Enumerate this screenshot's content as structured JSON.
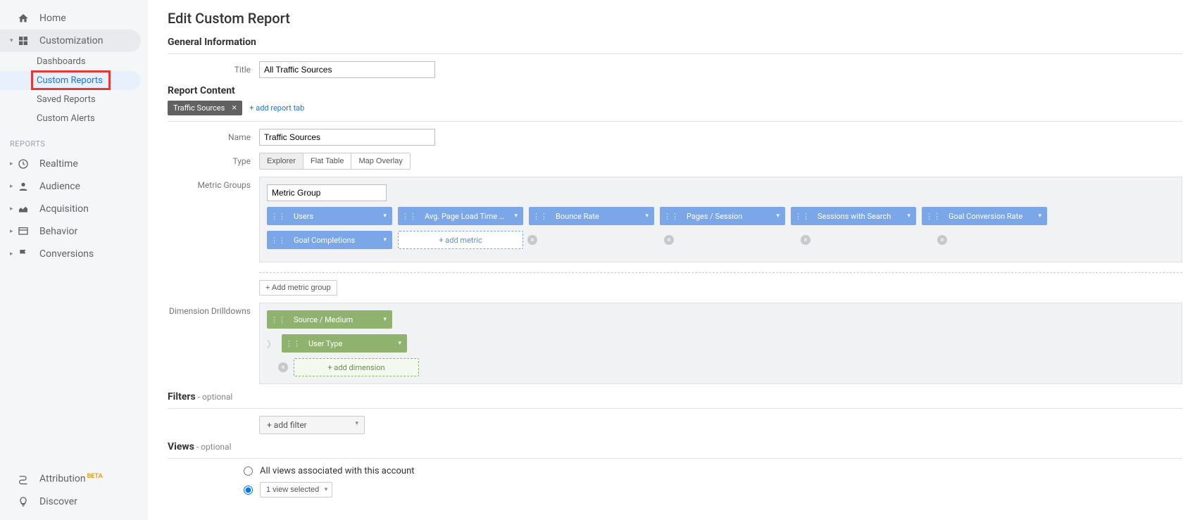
{
  "sidebar": {
    "home": "Home",
    "customization": "Customization",
    "sub": {
      "dashboards": "Dashboards",
      "custom_reports": "Custom Reports",
      "saved_reports": "Saved Reports",
      "custom_alerts": "Custom Alerts"
    },
    "reports_label": "REPORTS",
    "realtime": "Realtime",
    "audience": "Audience",
    "acquisition": "Acquisition",
    "behavior": "Behavior",
    "conversions": "Conversions",
    "attribution": "Attribution",
    "attribution_badge": "BETA",
    "discover": "Discover"
  },
  "page": {
    "title": "Edit Custom Report",
    "general_info": "General Information",
    "title_label": "Title",
    "title_value": "All Traffic Sources",
    "report_content": "Report Content",
    "tab_name": "Traffic Sources",
    "add_tab": "+ add report tab",
    "name_label": "Name",
    "name_value": "Traffic Sources",
    "type_label": "Type",
    "type_options": {
      "explorer": "Explorer",
      "flat": "Flat Table",
      "map": "Map Overlay"
    },
    "metric_groups_label": "Metric Groups",
    "metric_group_input": "Metric Group",
    "metrics": [
      "Users",
      "Avg. Page Load Time (s…",
      "Bounce Rate",
      "Pages / Session",
      "Sessions with Search",
      "Goal Conversion Rate",
      "Goal Completions"
    ],
    "add_metric": "+ add metric",
    "add_metric_group": "+ Add metric group",
    "dim_label": "Dimension Drilldowns",
    "dims": [
      "Source / Medium",
      "User Type"
    ],
    "add_dimension": "+ add dimension",
    "filters_label": "Filters",
    "optional": " - optional",
    "add_filter": "+ add filter",
    "views_label": "Views",
    "views_all": "All views associated with this account",
    "views_selected": "1 view selected"
  }
}
